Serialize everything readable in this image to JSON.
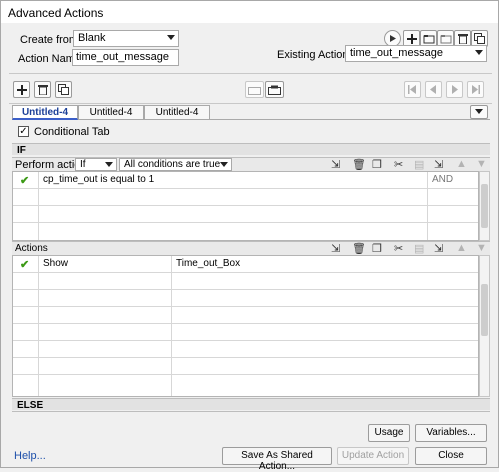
{
  "window": {
    "title": "Advanced Actions"
  },
  "form": {
    "create_from_label": "Create from:",
    "create_from_value": "Blank",
    "action_name_label": "Action Name:",
    "action_name_value": "time_out_message",
    "existing_actions_label": "Existing Actions:",
    "existing_actions_value": "time_out_message"
  },
  "tabs": [
    {
      "label": "Untitled-4",
      "active": true
    },
    {
      "label": "Untitled-4",
      "active": false
    },
    {
      "label": "Untitled-4",
      "active": false
    }
  ],
  "conditional": {
    "label": "Conditional Tab",
    "checked": true
  },
  "if_section": {
    "header": "IF",
    "perform_label": "Perform actions:",
    "perform_value": "If",
    "conditions_value": "All conditions are true",
    "rows": [
      {
        "enabled": true,
        "text": "cp_time_out   is equal to   1",
        "operator": "AND"
      }
    ]
  },
  "actions_section": {
    "header": "Actions",
    "rows": [
      {
        "enabled": true,
        "action": "Show",
        "target": "Time_out_Box"
      }
    ]
  },
  "else_section": {
    "header": "ELSE"
  },
  "buttons": {
    "usage": "Usage",
    "variables": "Variables...",
    "help": "Help...",
    "save_shared": "Save As Shared Action...",
    "update": "Update Action",
    "close": "Close"
  },
  "icons": {
    "check": "✔"
  },
  "colors": {
    "active_tab_text": "#1b3f98",
    "check": "#3c9a16",
    "link": "#1d4faa"
  }
}
